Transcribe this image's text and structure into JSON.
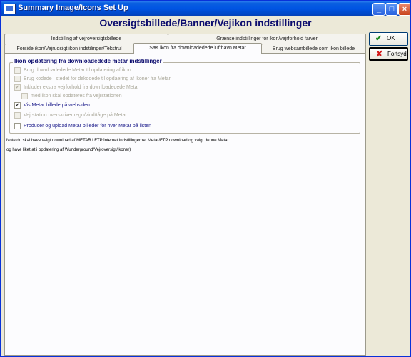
{
  "window": {
    "title": "Summary Image/Icons Set Up",
    "controls": {
      "minimize": "_",
      "maximize": "□",
      "close": "×"
    }
  },
  "header": {
    "title": "Oversigtsbillede/Banner/Vejikon indstillinger"
  },
  "tabs": {
    "row1": [
      {
        "label": "Indstilling af vejroversigtsbillede"
      },
      {
        "label": "Grænse indstillinger for ikon/vejrforhold farver"
      }
    ],
    "row2": [
      {
        "label": "Forside ikon/Vejrudsigt ikon indstilinger/Tekstrul"
      },
      {
        "label": "Sæt ikon fra downloadedede lufthavn Metar"
      },
      {
        "label": "Brug webcambillede som ikon billede"
      }
    ],
    "active": "Sæt ikon fra downloadedede lufthavn Metar"
  },
  "group": {
    "title": "Ikon opdatering fra downloadedede metar indstillinger",
    "options": [
      {
        "label": "Brug downloadedede Metar til opdatering af ikon",
        "checked": false,
        "enabled": false
      },
      {
        "label": "Brug kodede i stedet for dekodede til opdaering af ikoner fra Metar",
        "checked": false,
        "enabled": false
      },
      {
        "label": "Inkluder ekstra vejrforhold fra downloadedede Metar",
        "checked": true,
        "enabled": false
      },
      {
        "label": "med ikon skal opdateres fra vejrstationen",
        "checked": false,
        "enabled": false
      },
      {
        "label": "Vis Metar billede på websiden",
        "checked": true,
        "enabled": true
      },
      {
        "label": "Vejrstation overskriver regn/vind/tåge på Metar",
        "checked": false,
        "enabled": false
      },
      {
        "label": "Producer og upload Metar billeder for hver Metar på listen",
        "checked": false,
        "enabled": true
      }
    ]
  },
  "note": {
    "line1": "Note du skal have valgt download af METAR i FTP/internet indstillingerne, Metar/FTP download og valgt denne Metar",
    "line2": "og have liket at i opdatering af Wunderground/Vejroversigt/ikoner)"
  },
  "buttons": {
    "ok_label": "OK",
    "cancel_label": "Fortsyd"
  },
  "icons": {
    "ok": "checkmark-icon",
    "cancel": "x-icon",
    "check": "✔"
  },
  "colors": {
    "accent": "#0054e3",
    "title_text": "#0c0c6e",
    "enabled_text": "#1a1a8a"
  }
}
